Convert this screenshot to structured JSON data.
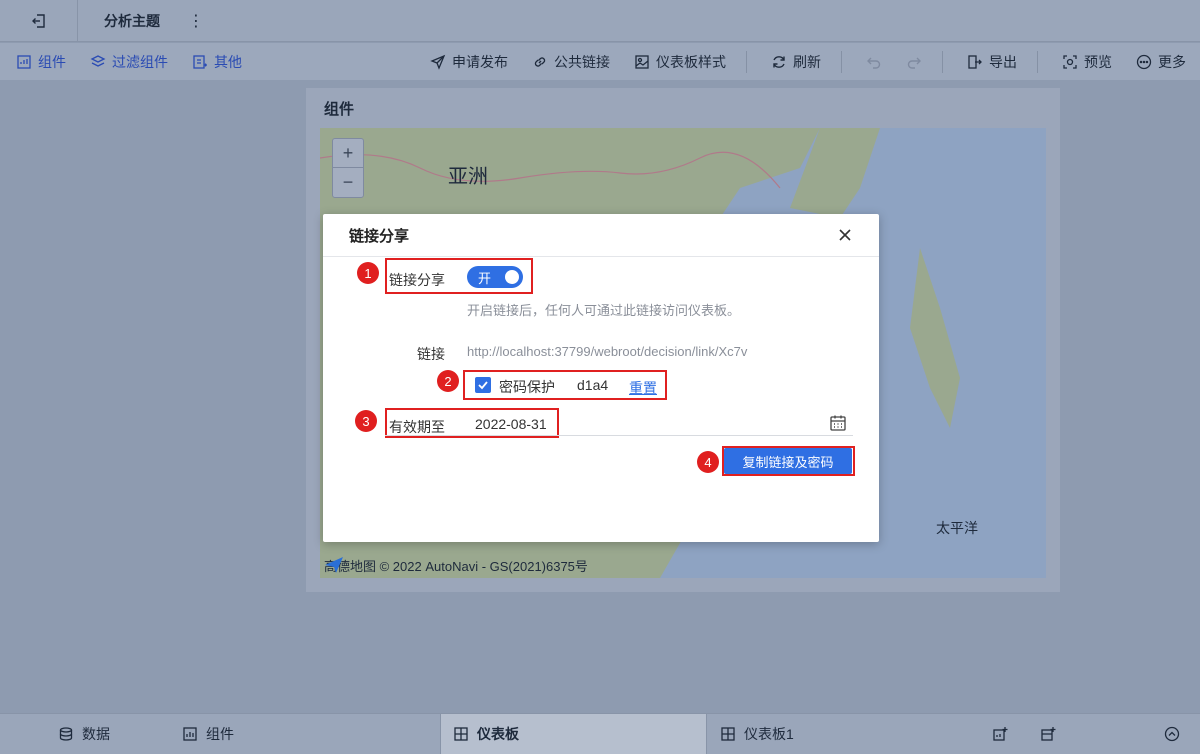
{
  "titlebar": {
    "title": "分析主题",
    "more_label": "⋮"
  },
  "toolbar": {
    "left": [
      {
        "label": "组件",
        "icon": "component-icon"
      },
      {
        "label": "过滤组件",
        "icon": "filter-component-icon"
      },
      {
        "label": "其他",
        "icon": "other-icon"
      }
    ],
    "right": [
      {
        "label": "申请发布",
        "icon": "send-icon"
      },
      {
        "label": "公共链接",
        "icon": "link-icon"
      },
      {
        "label": "仪表板样式",
        "icon": "style-icon"
      },
      {
        "label": "刷新",
        "icon": "refresh-icon"
      },
      {
        "label": "导出",
        "icon": "export-icon"
      },
      {
        "label": "预览",
        "icon": "preview-icon"
      },
      {
        "label": "更多",
        "icon": "more-icon"
      }
    ]
  },
  "widget": {
    "title": "组件",
    "map": {
      "label_asia": "亚洲",
      "label_pacific": "太平洋",
      "zoom_in": "+",
      "zoom_out": "−",
      "attribution": "高德地图 © 2022 AutoNavi - GS(2021)6375号"
    }
  },
  "dialog": {
    "title": "链接分享",
    "share_label": "链接分享",
    "toggle_text": "开",
    "toggle_on": true,
    "hint": "开启链接后，任何人可通过此链接访问仪表板。",
    "link_label": "链接",
    "link_url": "http://localhost:37799/webroot/decision/link/Xc7v",
    "password_checked": true,
    "password_label": "密码保护",
    "password_value": "d1a4",
    "reset_label": "重置",
    "expire_label": "有效期至",
    "expire_value": "2022-08-31",
    "copy_button": "复制链接及密码",
    "badges": [
      "1",
      "2",
      "3",
      "4"
    ],
    "highlight_color": "#e02020",
    "accent_color": "#2f6fe3"
  },
  "bottombar": {
    "data_label": "数据",
    "component_label": "组件",
    "tabs": [
      {
        "label": "仪表板",
        "active": true
      },
      {
        "label": "仪表板1",
        "active": false
      }
    ]
  }
}
